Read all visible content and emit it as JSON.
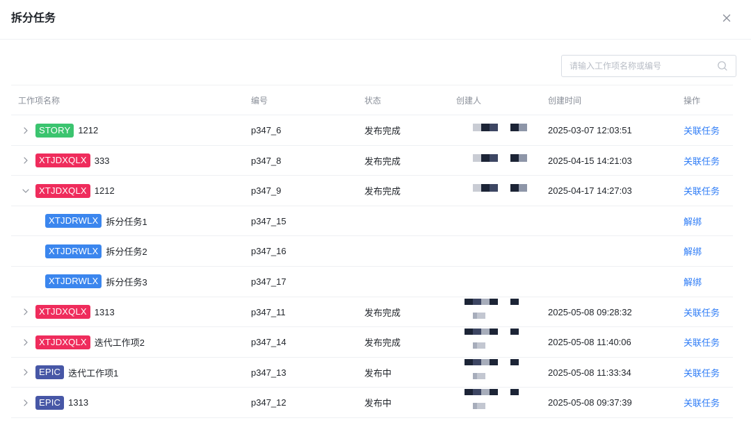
{
  "modal": {
    "title": "拆分任务",
    "close_icon": "close-icon"
  },
  "search": {
    "placeholder": "请输入工作项名称或编号",
    "value": ""
  },
  "columns": {
    "name": "工作项名称",
    "code": "编号",
    "status": "状态",
    "creator": "创建人",
    "created_at": "创建时间",
    "actions": "操作"
  },
  "tag_colors": {
    "STORY": "#3bc46f",
    "XTJDXQLX": "#ef2c5c",
    "XTJDRWLX": "#3b86ee",
    "EPIC": "#4757a6"
  },
  "rows": [
    {
      "expand": "collapsed",
      "tag": "STORY",
      "name": "1212",
      "code": "p347_6",
      "status": "发布完成",
      "creator_masked": true,
      "created_at": "2025-03-07 12:03:51",
      "action": "关联任务"
    },
    {
      "expand": "collapsed",
      "tag": "XTJDXQLX",
      "name": "333",
      "code": "p347_8",
      "status": "发布完成",
      "creator_masked": true,
      "created_at": "2025-04-15 14:21:03",
      "action": "关联任务"
    },
    {
      "expand": "expanded",
      "tag": "XTJDXQLX",
      "name": "1212",
      "code": "p347_9",
      "status": "发布完成",
      "creator_masked": true,
      "created_at": "2025-04-17 14:27:03",
      "action": "关联任务"
    },
    {
      "expand": "child",
      "tag": "XTJDRWLX",
      "name": "拆分任务1",
      "code": "p347_15",
      "status": "",
      "creator_masked": false,
      "created_at": "",
      "action": "解绑"
    },
    {
      "expand": "child",
      "tag": "XTJDRWLX",
      "name": "拆分任务2",
      "code": "p347_16",
      "status": "",
      "creator_masked": false,
      "created_at": "",
      "action": "解绑"
    },
    {
      "expand": "child",
      "tag": "XTJDRWLX",
      "name": "拆分任务3",
      "code": "p347_17",
      "status": "",
      "creator_masked": false,
      "created_at": "",
      "action": "解绑"
    },
    {
      "expand": "collapsed",
      "tag": "XTJDXQLX",
      "name": "1313",
      "code": "p347_11",
      "status": "发布完成",
      "creator_masked": true,
      "created_at": "2025-05-08 09:28:32",
      "action": "关联任务"
    },
    {
      "expand": "collapsed",
      "tag": "XTJDXQLX",
      "name": "迭代工作项2",
      "code": "p347_14",
      "status": "发布完成",
      "creator_masked": true,
      "created_at": "2025-05-08 11:40:06",
      "action": "关联任务"
    },
    {
      "expand": "collapsed",
      "tag": "EPIC",
      "name": "迭代工作项1",
      "code": "p347_13",
      "status": "发布中",
      "creator_masked": true,
      "created_at": "2025-05-08 11:33:34",
      "action": "关联任务"
    },
    {
      "expand": "collapsed",
      "tag": "EPIC",
      "name": "1313",
      "code": "p347_12",
      "status": "发布中",
      "creator_masked": true,
      "created_at": "2025-05-08 09:37:39",
      "action": "关联任务"
    }
  ]
}
